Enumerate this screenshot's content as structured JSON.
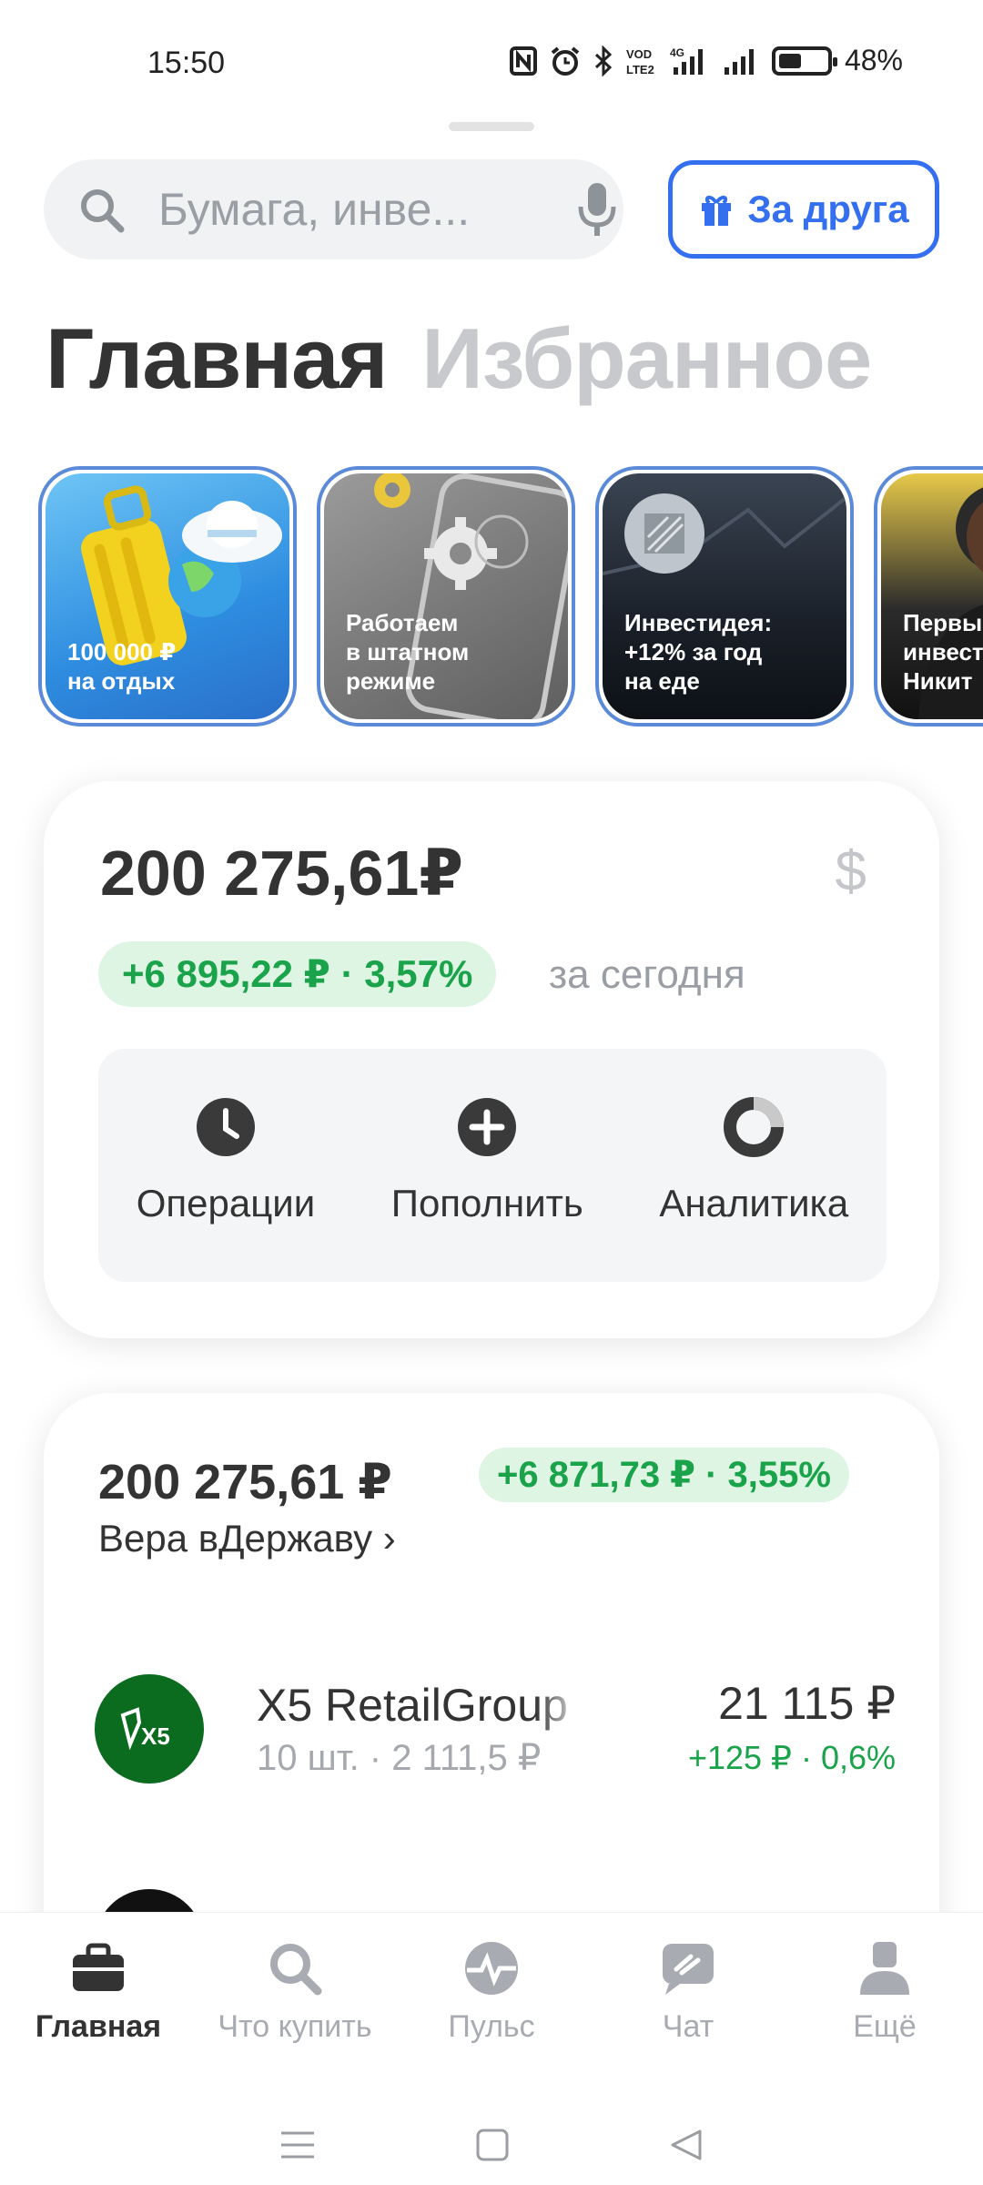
{
  "status_bar": {
    "time": "15:50",
    "network": "4G",
    "battery_level": 0.48,
    "battery_percent": "48%"
  },
  "search": {
    "placeholder": "Бумага, инве..."
  },
  "invite_button": {
    "label": "За друга"
  },
  "page_tabs": [
    {
      "label": "Главная",
      "active": true
    },
    {
      "label": "Избранное",
      "active": false
    }
  ],
  "stories": [
    {
      "text": "100 000 ₽\nна отдых"
    },
    {
      "text": "Работаем\nв штатном\nрежиме"
    },
    {
      "text": "Инвестидея:\n+12% за год\nна еде"
    },
    {
      "text": "Первые\nинвест\nНикит"
    }
  ],
  "balance": {
    "amount": "200 275,61₽",
    "currency_switch": "$",
    "change": "+6 895,22 ₽ · 3,57%",
    "period": "за сегодня",
    "actions": [
      {
        "label": "Операции",
        "icon": "clock-icon"
      },
      {
        "label": "Пополнить",
        "icon": "plus-icon"
      },
      {
        "label": "Аналитика",
        "icon": "donut-chart-icon"
      }
    ]
  },
  "portfolio": {
    "total": "200 275,61 ₽",
    "change": "+6 871,73 ₽ · 3,55%",
    "name": "Вера вДержаву ›",
    "holdings": [
      {
        "logo": "X5",
        "name": "X5 RetailGroup",
        "quantity": "10 шт. · 2 111,5 ₽",
        "value": "21 115 ₽",
        "change": "+125 ₽ · 0,6%"
      }
    ]
  },
  "bottom_nav": [
    {
      "label": "Главная",
      "icon": "briefcase-icon",
      "active": true
    },
    {
      "label": "Что купить",
      "icon": "search-icon",
      "active": false
    },
    {
      "label": "Пульс",
      "icon": "pulse-icon",
      "active": false
    },
    {
      "label": "Чат",
      "icon": "chat-icon",
      "active": false
    },
    {
      "label": "Ещё",
      "icon": "profile-icon",
      "active": false
    }
  ],
  "colors": {
    "accent": "#336fee",
    "positive": "#1aa34a",
    "positive_bg": "#dff5e4",
    "text": "#333333",
    "muted": "#a8abb1"
  }
}
